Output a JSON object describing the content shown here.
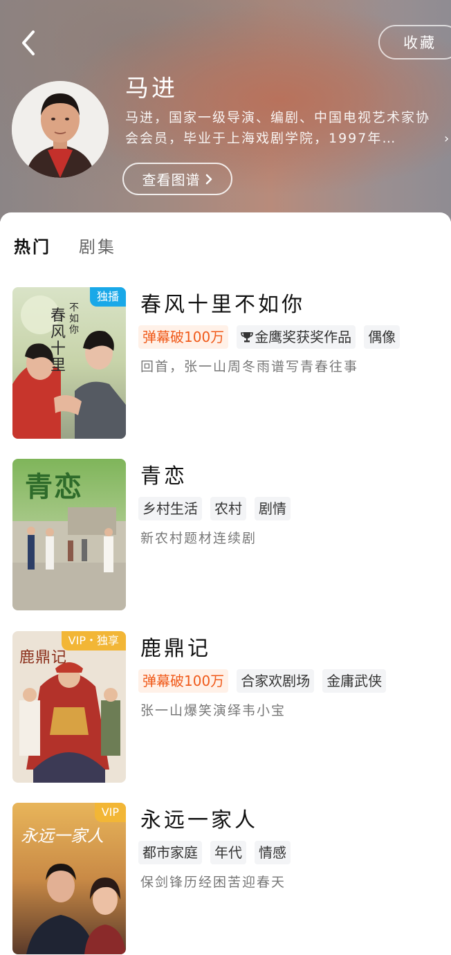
{
  "header": {
    "back_icon": "chevron-left-icon",
    "favorite_label": "收藏",
    "person_name": "马进",
    "bio": "马进，国家一级导演、编剧、中国电视艺术家协会会员，毕业于上海戏剧学院，1997年…",
    "bio_more": "›",
    "graph_button_label": "查看图谱"
  },
  "tabs": [
    {
      "label": "热门",
      "active": true
    },
    {
      "label": "剧集",
      "active": false
    }
  ],
  "shows": [
    {
      "title": "春风十里不如你",
      "badge": "独播",
      "badge_color": "#19a8e8",
      "tags": [
        {
          "label": "弹幕破100万",
          "hot": true
        },
        {
          "label": "金鹰奖获奖作品",
          "icon": "trophy-icon"
        },
        {
          "label": "偶像"
        }
      ],
      "desc": "回首，张一山周冬雨谱写青春往事",
      "poster_text": "春风十里",
      "poster_subtext": "不如你"
    },
    {
      "title": "青恋",
      "badge": "",
      "tags": [
        {
          "label": "乡村生活"
        },
        {
          "label": "农村"
        },
        {
          "label": "剧情"
        }
      ],
      "desc": "新农村题材连续剧",
      "poster_text": "青恋"
    },
    {
      "title": "鹿鼎记",
      "badge": "VIP・独享",
      "badge_color": "#f2b636",
      "tags": [
        {
          "label": "弹幕破100万",
          "hot": true
        },
        {
          "label": "合家欢剧场"
        },
        {
          "label": "金庸武侠"
        }
      ],
      "desc": "张一山爆笑演绎韦小宝",
      "poster_text": "鹿鼎记"
    },
    {
      "title": "永远一家人",
      "badge": "VIP",
      "badge_color": "#f2b636",
      "tags": [
        {
          "label": "都市家庭"
        },
        {
          "label": "年代"
        },
        {
          "label": "情感"
        }
      ],
      "desc": "保剑锋历经困苦迎春天",
      "poster_text": "永远一家人"
    }
  ]
}
